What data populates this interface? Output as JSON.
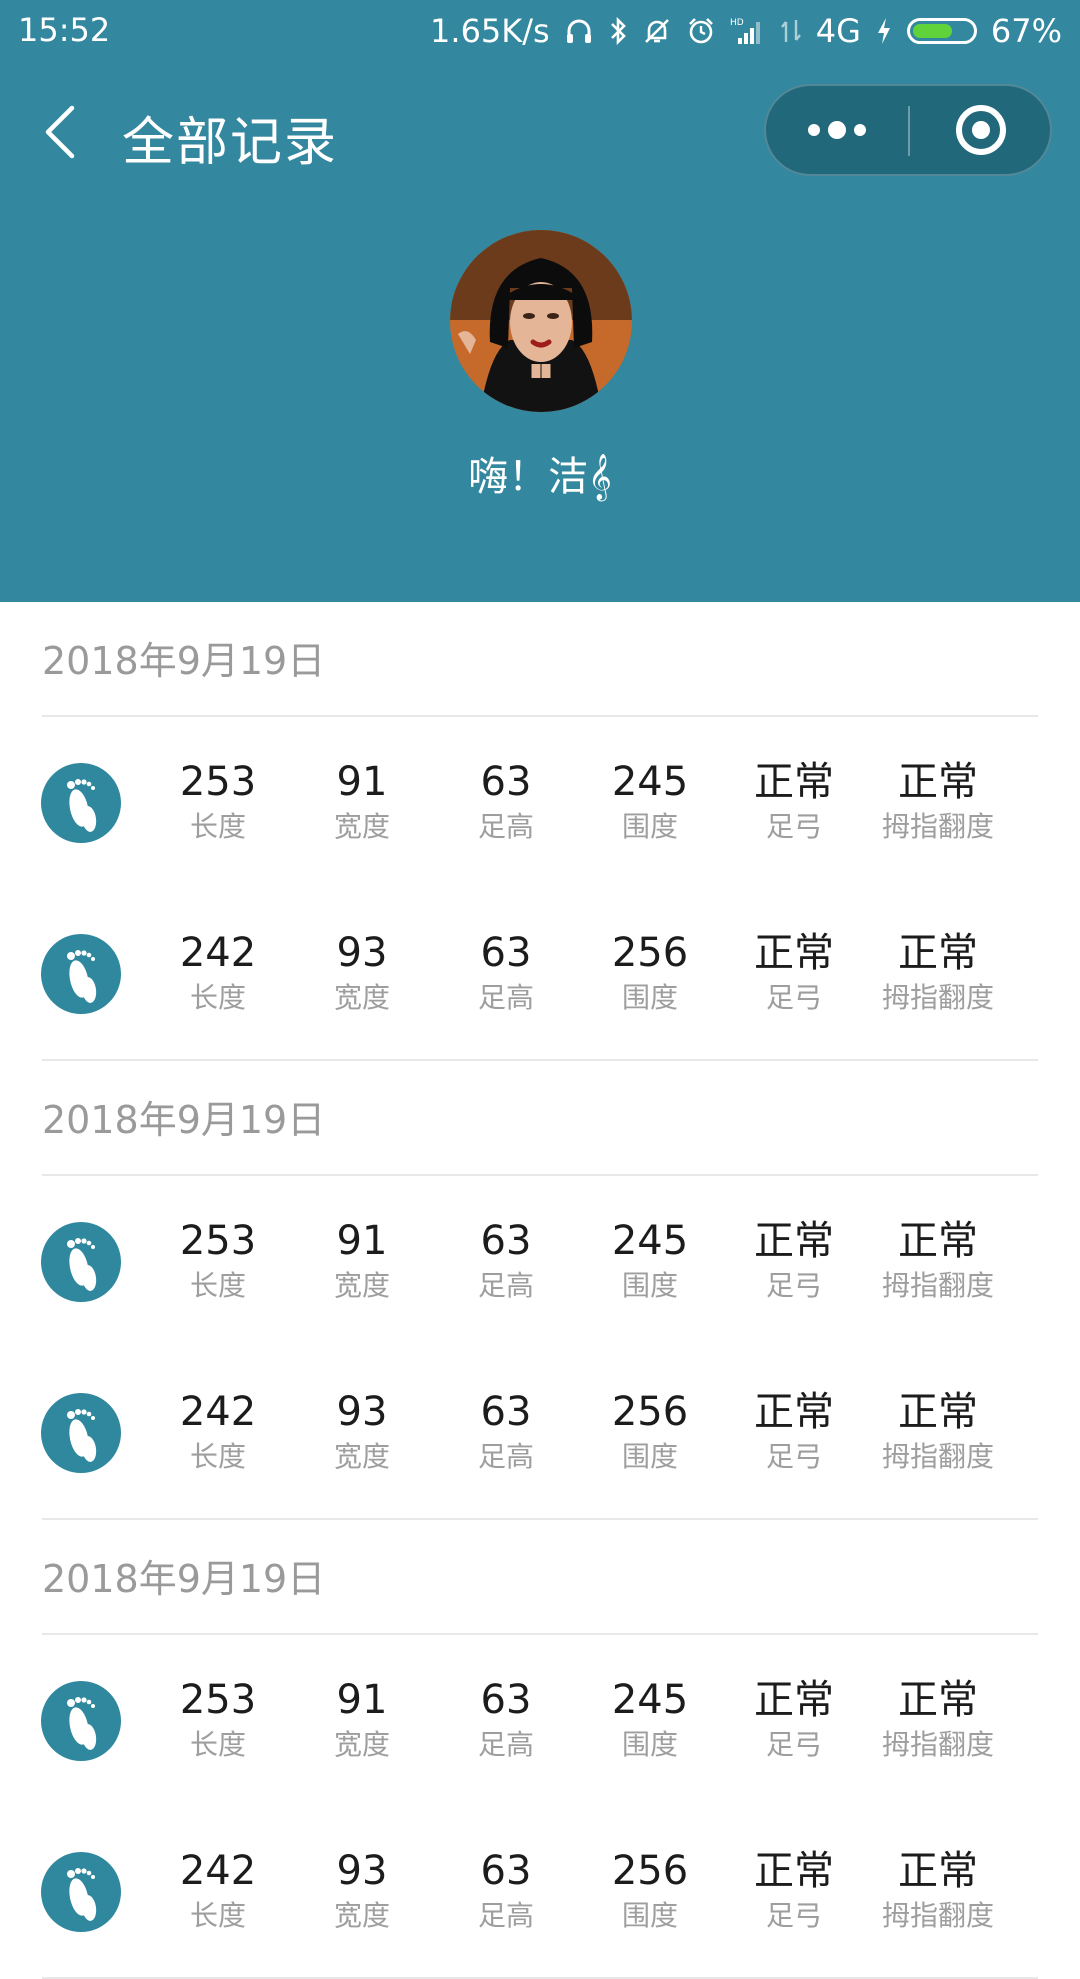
{
  "status_bar": {
    "time": "15:52",
    "net_speed": "1.65K/s",
    "network_type": "4G",
    "battery_percent": "67%",
    "battery_level": 0.67,
    "icons": [
      "headphones-icon",
      "bluetooth-icon",
      "notifications-off-icon",
      "alarm-icon",
      "hd-signal-icon",
      "data-arrows-icon",
      "charging-icon",
      "battery-icon"
    ]
  },
  "nav": {
    "back_icon": "chevron-left-icon",
    "title": "全部记录",
    "capsule": {
      "more_icon": "more-dots-icon",
      "close_icon": "target-circle-icon"
    }
  },
  "profile": {
    "greeting": "嗨！洁𝄞"
  },
  "colors": {
    "header_bg": "#33879e",
    "icon_bg": "#2f889e",
    "battery_fill": "#61d33a"
  },
  "labels": {
    "length": "长度",
    "width": "宽度",
    "height": "足高",
    "girth": "围度",
    "arch": "足弓",
    "hallux": "拇指翻度"
  },
  "groups": [
    {
      "date": "2018年9月19日",
      "rows": [
        {
          "icon": "footprint-icon",
          "length": "253",
          "width": "91",
          "height": "63",
          "girth": "245",
          "arch": "正常",
          "hallux": "正常"
        },
        {
          "icon": "footprint-icon",
          "length": "242",
          "width": "93",
          "height": "63",
          "girth": "256",
          "arch": "正常",
          "hallux": "正常"
        }
      ]
    },
    {
      "date": "2018年9月19日",
      "rows": [
        {
          "icon": "footprint-icon",
          "length": "253",
          "width": "91",
          "height": "63",
          "girth": "245",
          "arch": "正常",
          "hallux": "正常"
        },
        {
          "icon": "footprint-icon",
          "length": "242",
          "width": "93",
          "height": "63",
          "girth": "256",
          "arch": "正常",
          "hallux": "正常"
        }
      ]
    },
    {
      "date": "2018年9月19日",
      "rows": [
        {
          "icon": "footprint-icon",
          "length": "253",
          "width": "91",
          "height": "63",
          "girth": "245",
          "arch": "正常",
          "hallux": "正常"
        },
        {
          "icon": "footprint-icon",
          "length": "242",
          "width": "93",
          "height": "63",
          "girth": "256",
          "arch": "正常",
          "hallux": "正常"
        }
      ]
    }
  ]
}
